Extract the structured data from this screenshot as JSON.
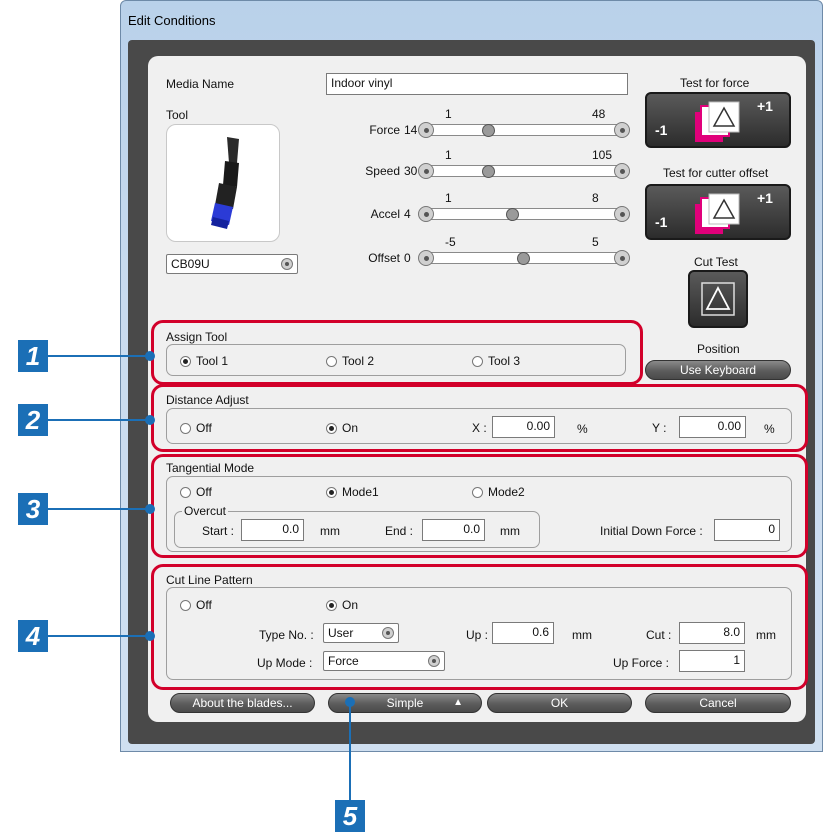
{
  "window": {
    "title": "Edit Conditions"
  },
  "media": {
    "name_label": "Media Name",
    "name_value": "Indoor vinyl"
  },
  "tool": {
    "label": "Tool",
    "selected": "CB09U"
  },
  "sliders": [
    {
      "label": "Force",
      "value": "14",
      "min": "1",
      "max": "48",
      "position": 0.28
    },
    {
      "label": "Speed",
      "value": "30",
      "min": "1",
      "max": "105",
      "position": 0.28
    },
    {
      "label": "Accel",
      "value": "4",
      "min": "1",
      "max": "8",
      "position": 0.43
    },
    {
      "label": "Offset",
      "value": "0",
      "min": "-5",
      "max": "5",
      "position": 0.5
    }
  ],
  "tests": {
    "force_label": "Test for force",
    "offset_label": "Test for cutter offset",
    "cut_label": "Cut Test",
    "minus": "-1",
    "plus": "+1",
    "position_label": "Position",
    "keyboard_button": "Use Keyboard"
  },
  "assign_tool": {
    "title": "Assign Tool",
    "options": [
      "Tool 1",
      "Tool 2",
      "Tool 3"
    ],
    "selected": "Tool 1"
  },
  "distance_adjust": {
    "title": "Distance Adjust",
    "off": "Off",
    "on": "On",
    "selected": "On",
    "x_label": "X :",
    "x_value": "0.00",
    "x_unit": "%",
    "y_label": "Y :",
    "y_value": "0.00",
    "y_unit": "%"
  },
  "tangential": {
    "title": "Tangential Mode",
    "off": "Off",
    "mode1": "Mode1",
    "mode2": "Mode2",
    "selected": "Mode1",
    "overcut_title": "Overcut",
    "start_label": "Start :",
    "start_value": "0.0",
    "start_unit": "mm",
    "end_label": "End :",
    "end_value": "0.0",
    "end_unit": "mm",
    "initial_force_label": "Initial Down Force :",
    "initial_force_value": "0"
  },
  "cut_line": {
    "title": "Cut Line Pattern",
    "off": "Off",
    "on": "On",
    "selected": "On",
    "type_label": "Type No. :",
    "type_value": "User",
    "up_label": "Up :",
    "up_value": "0.6",
    "up_unit": "mm",
    "cut_label": "Cut :",
    "cut_value": "8.0",
    "cut_unit": "mm",
    "upmode_label": "Up Mode :",
    "upmode_value": "Force",
    "upforce_label": "Up Force :",
    "upforce_value": "1"
  },
  "buttons": {
    "about": "About the blades...",
    "simple": "Simple",
    "ok": "OK",
    "cancel": "Cancel"
  },
  "callouts": [
    "1",
    "2",
    "3",
    "4",
    "5"
  ],
  "colors": {
    "highlight": "#d2002a",
    "callout": "#1b6fb6",
    "test_icon": "#e0007a"
  }
}
